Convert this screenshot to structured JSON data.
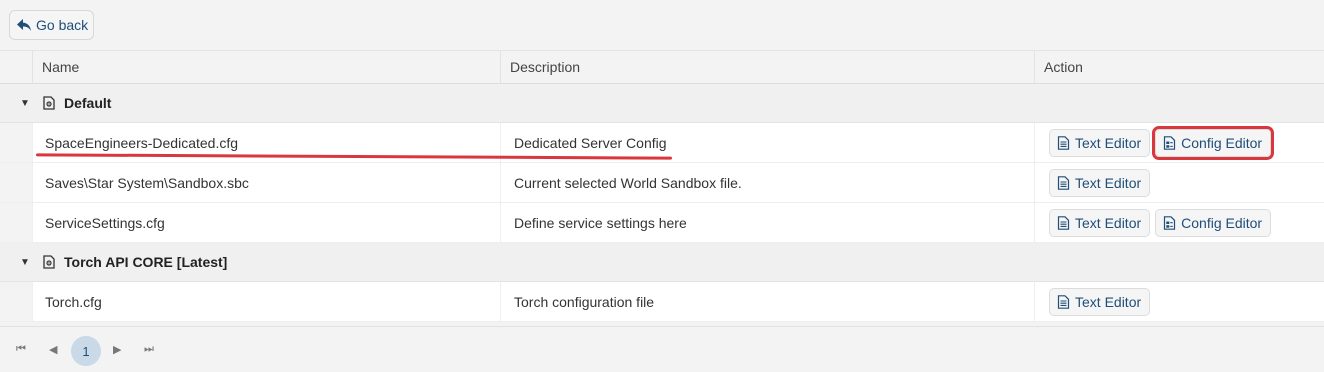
{
  "toolbar": {
    "back_label": "Go back"
  },
  "table": {
    "columns": {
      "name": "Name",
      "description": "Description",
      "action": "Action"
    },
    "groups": [
      {
        "title": "Default",
        "rows": [
          {
            "name": "SpaceEngineers-Dedicated.cfg",
            "description": "Dedicated Server Config",
            "actions": [
              "Text Editor",
              "Config Editor"
            ]
          },
          {
            "name": "Saves\\Star System\\Sandbox.sbc",
            "description": "Current selected World Sandbox file.",
            "actions": [
              "Text Editor"
            ]
          },
          {
            "name": "ServiceSettings.cfg",
            "description": "Define service settings here",
            "actions": [
              "Text Editor",
              "Config Editor"
            ]
          }
        ]
      },
      {
        "title": "Torch API CORE [Latest]",
        "rows": [
          {
            "name": "Torch.cfg",
            "description": "Torch configuration file",
            "actions": [
              "Text Editor"
            ]
          }
        ]
      }
    ]
  },
  "pager": {
    "current_page": "1"
  },
  "colors": {
    "accent": "#1f4e79",
    "annotation": "#d9363e",
    "page_active_bg": "#c9d9e8"
  }
}
